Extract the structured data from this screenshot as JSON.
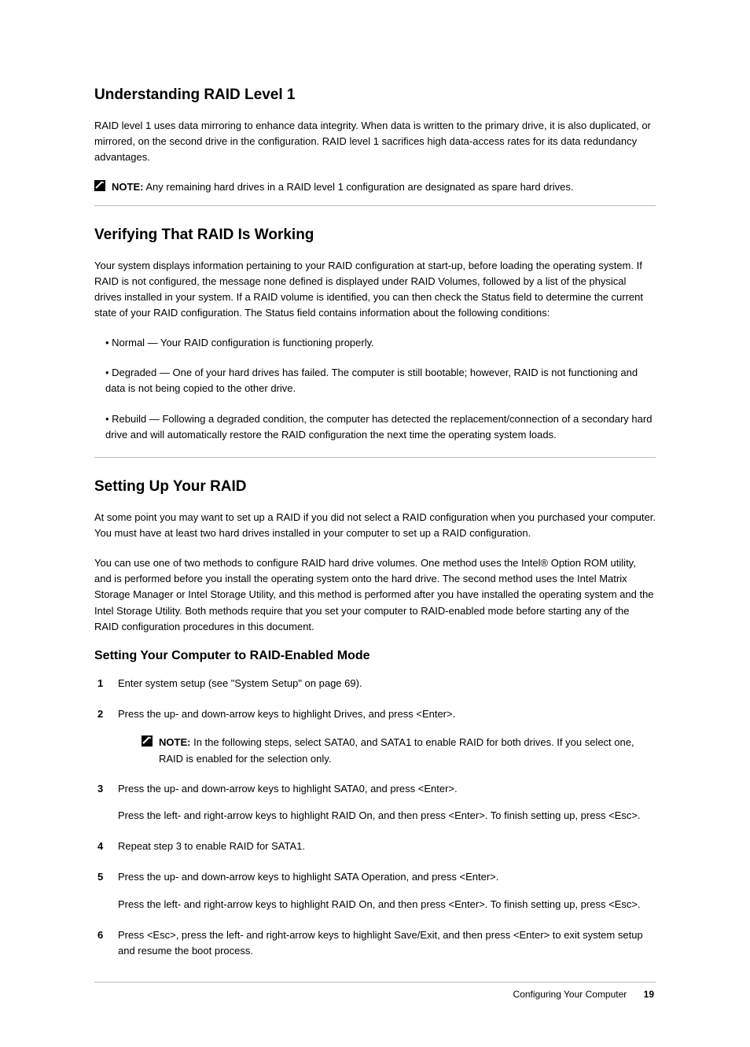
{
  "section1": {
    "heading": "Understanding RAID Level 1",
    "para": "RAID level 1 uses data mirroring to enhance data integrity. When data is written to the primary drive, it is also duplicated, or mirrored, on the second drive in the configuration. RAID level 1 sacrifices high data-access rates for its data redundancy advantages.",
    "note_label": "NOTE:",
    "note_body": "Any remaining hard drives in a RAID level 1 configuration are designated as spare hard drives."
  },
  "divider1": true,
  "section2": {
    "heading": "Verifying That RAID Is Working",
    "para1": "Your system displays information pertaining to your RAID configuration at start-up, before loading the operating system. If RAID is not configured, the message none defined is displayed under RAID Volumes, followed by a list of the physical drives installed in your system. If a RAID volume is identified, you can then check the Status field to determine the current state of your RAID configuration. The Status field contains information about the following conditions:",
    "bul1": "Normal — Your RAID configuration is functioning properly.",
    "bul2": "Degraded — One of your hard drives has failed. The computer is still bootable; however, RAID is not functioning and data is not being copied to the other drive.",
    "bul3": "Rebuild — Following a degraded condition, the computer has detected the replacement/connection of a secondary hard drive and will automatically restore the RAID configuration the next time the operating system loads."
  },
  "divider2": true,
  "section3": {
    "heading": "Setting Up Your RAID",
    "para1": "At some point you may want to set up a RAID if you did not select a RAID configuration when you purchased your computer. You must have at least two hard drives installed in your computer to set up a RAID configuration.",
    "para2": "You can use one of two methods to configure RAID hard drive volumes. One method uses the Intel® Option ROM utility, and is performed before you install the operating system onto the hard drive. The second method uses the Intel Matrix Storage Manager or Intel Storage Utility, and this method is performed after you have installed the operating system and the Intel Storage Utility. Both methods require that you set your computer to RAID-enabled mode before starting any of the RAID configuration procedures in this document.",
    "sub_heading": "Setting Your Computer to RAID-Enabled Mode",
    "steps": {
      "s1": "Enter system setup (see \"System Setup\" on page 69).",
      "s2a": "Press the up- and down-arrow keys to highlight Drives, and press <Enter>.",
      "s2_note_label": "NOTE:",
      "s2_note_body": "In the following steps, select SATA0, and SATA1 to enable RAID for both drives. If you select one, RAID is enabled for the selection only.",
      "s3a": "Press the up- and down-arrow keys to highlight SATA0, and press <Enter>.",
      "s3b": "Press the left- and right-arrow keys to highlight RAID On, and then press <Enter>. To finish setting up, press <Esc>.",
      "s4": "Repeat step 3 to enable RAID for SATA1.",
      "s5a": "Press the up- and down-arrow keys to highlight SATA Operation, and press <Enter>.",
      "s5b": "Press the left- and right-arrow keys to highlight RAID On, and then press <Enter>. To finish setting up, press <Esc>.",
      "s6": "Press <Esc>, press the left- and right-arrow keys to highlight Save/Exit, and then press <Enter> to exit system setup and resume the boot process."
    }
  },
  "footer": {
    "title": "Configuring Your Computer",
    "page": "19"
  }
}
